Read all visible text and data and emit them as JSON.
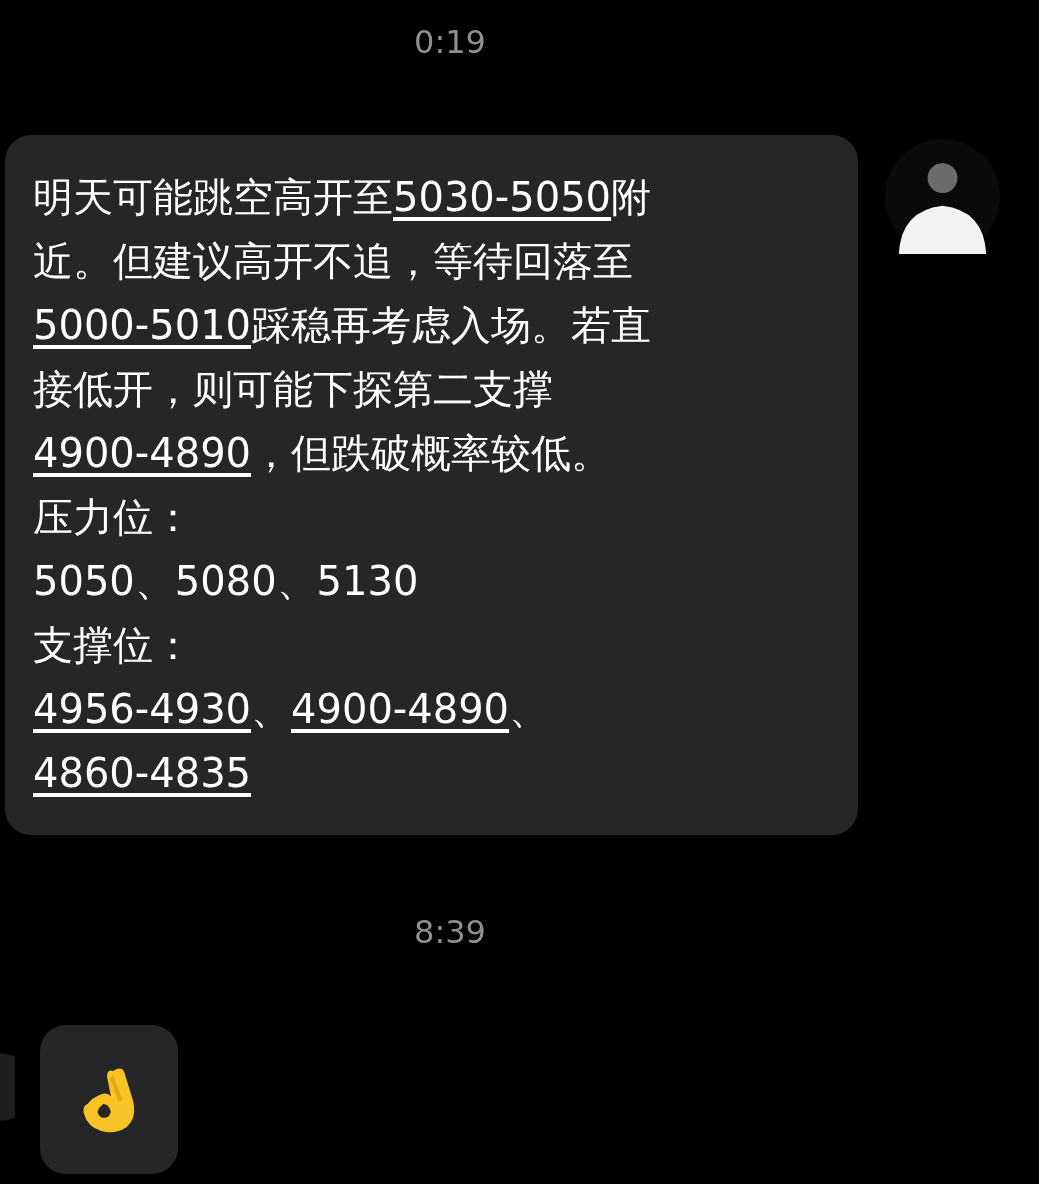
{
  "messages": [
    {
      "kind": "time",
      "text": "0:19"
    },
    {
      "kind": "text",
      "segments": [
        {
          "kind": "text",
          "text": "明天可能跳空高开至"
        },
        {
          "kind": "link",
          "text": "5030-5050"
        },
        {
          "kind": "text",
          "text": "附"
        },
        {
          "kind": "break"
        },
        {
          "kind": "text",
          "text": "近。但建议高开不追，等待回落至"
        },
        {
          "kind": "break"
        },
        {
          "kind": "link",
          "text": "5000-5010"
        },
        {
          "kind": "text",
          "text": "踩稳再考虑入场。若直"
        },
        {
          "kind": "break"
        },
        {
          "kind": "text",
          "text": "接低开，则可能下探第二支撑"
        },
        {
          "kind": "break"
        },
        {
          "kind": "link",
          "text": "4900-4890"
        },
        {
          "kind": "text",
          "text": "，但跌破概率较低。"
        },
        {
          "kind": "break"
        },
        {
          "kind": "text",
          "text": "压力位："
        },
        {
          "kind": "break"
        },
        {
          "kind": "text",
          "text": "5050、5080、5130"
        },
        {
          "kind": "break"
        },
        {
          "kind": "text",
          "text": "支撑位："
        },
        {
          "kind": "break"
        },
        {
          "kind": "link",
          "text": "4956-4930"
        },
        {
          "kind": "text",
          "text": "、"
        },
        {
          "kind": "link",
          "text": "4900-4890"
        },
        {
          "kind": "text",
          "text": "、"
        },
        {
          "kind": "break"
        },
        {
          "kind": "link",
          "text": "4860-4835"
        }
      ]
    },
    {
      "kind": "time",
      "text": "8:39"
    },
    {
      "kind": "emoji"
    }
  ]
}
